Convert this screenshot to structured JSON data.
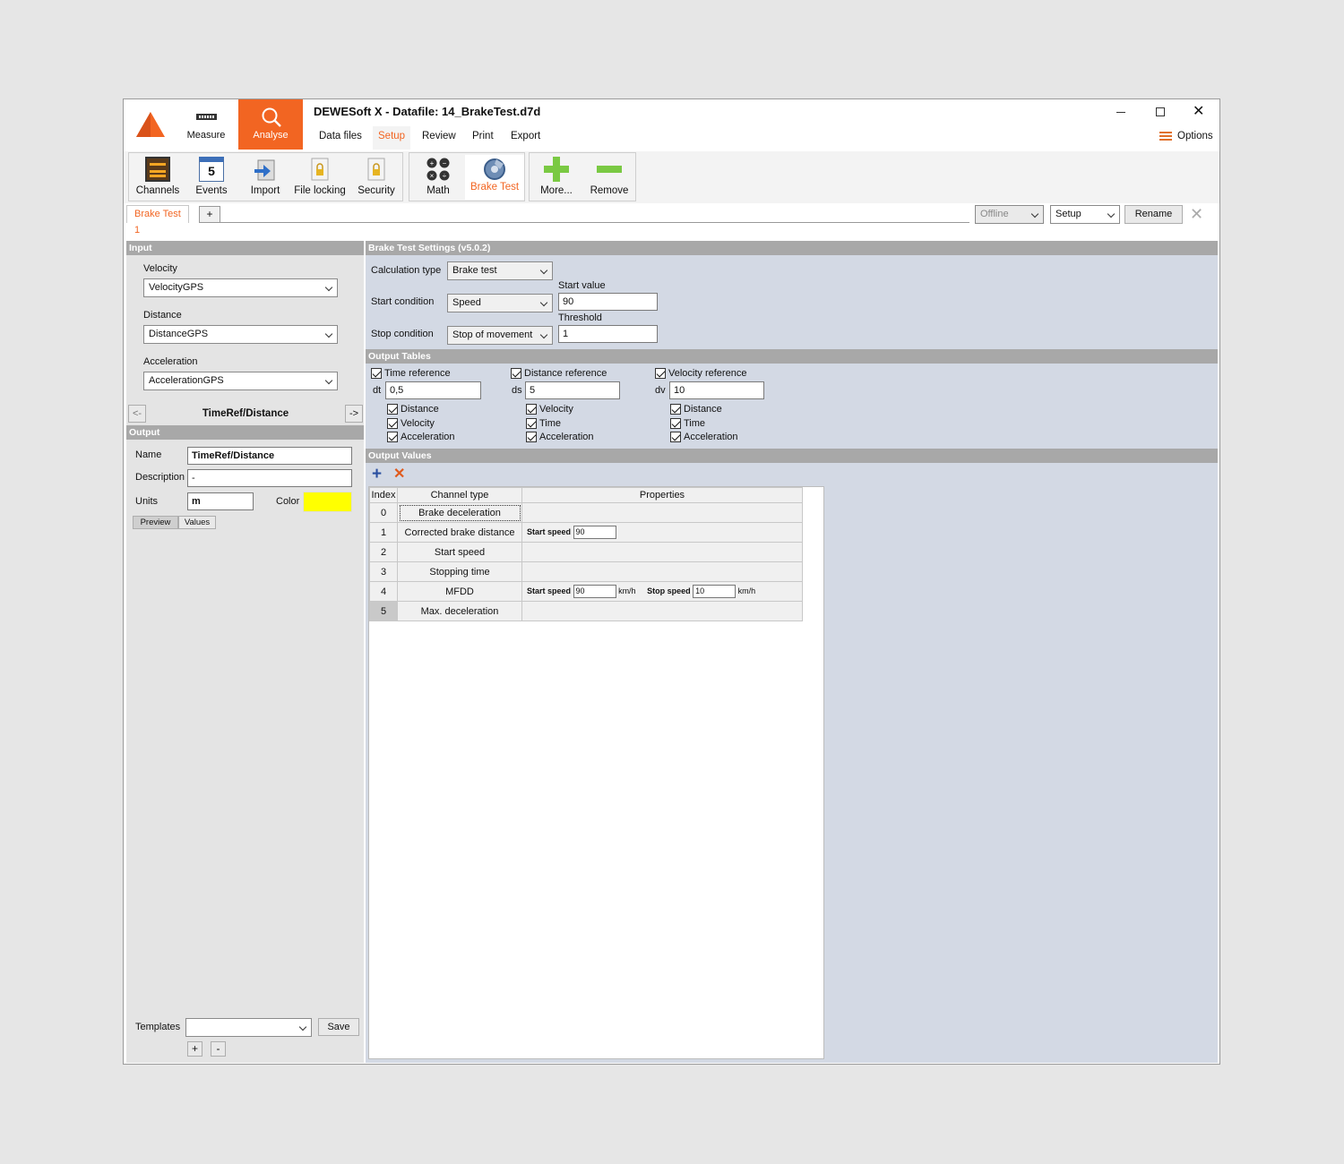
{
  "window": {
    "title": "DEWESoft X - Datafile: 14_BrakeTest.d7d",
    "options_label": "Options"
  },
  "modes": {
    "measure": "Measure",
    "analyse": "Analyse"
  },
  "menu": [
    "Data files",
    "Setup",
    "Review",
    "Print",
    "Export"
  ],
  "toolbar": {
    "channels": "Channels",
    "events": "Events",
    "import": "Import",
    "file_locking": "File locking",
    "security": "Security",
    "math": "Math",
    "brake_test": "Brake Test",
    "more": "More...",
    "remove": "Remove",
    "events_number": "5"
  },
  "tabs": {
    "active": "Brake Test 1",
    "add": "+"
  },
  "header_controls": {
    "offline": "Offline",
    "setup": "Setup",
    "rename": "Rename"
  },
  "input": {
    "section": "Input",
    "velocity_label": "Velocity",
    "velocity_value": "VelocityGPS",
    "distance_label": "Distance",
    "distance_value": "DistanceGPS",
    "acceleration_label": "Acceleration",
    "acceleration_value": "AccelerationGPS",
    "nav_prev": "<-",
    "nav_next": "->",
    "nav_title": "TimeRef/Distance"
  },
  "output": {
    "section": "Output",
    "name_label": "Name",
    "name_value": "TimeRef/Distance",
    "description_label": "Description",
    "description_value": "-",
    "units_label": "Units",
    "units_value": "m",
    "color_label": "Color",
    "color_value": "#ffff00",
    "preview_tab": "Preview",
    "values_tab": "Values"
  },
  "templates": {
    "label": "Templates",
    "save": "Save",
    "add": "+",
    "remove": "-"
  },
  "settings": {
    "section": "Brake Test Settings  (v5.0.2)",
    "calc_type_label": "Calculation type",
    "calc_type_value": "Brake test",
    "start_cond_label": "Start condition",
    "start_cond_value": "Speed",
    "start_value_label": "Start value",
    "start_value": "90",
    "stop_cond_label": "Stop condition",
    "stop_cond_value": "Stop of movement",
    "threshold_label": "Threshold",
    "threshold_value": "1"
  },
  "output_tables": {
    "section": "Output Tables",
    "time_ref": {
      "label": "Time reference",
      "var": "dt",
      "value": "0,5",
      "items": [
        "Distance",
        "Velocity",
        "Acceleration"
      ]
    },
    "distance_ref": {
      "label": "Distance reference",
      "var": "ds",
      "value": "5",
      "items": [
        "Velocity",
        "Time",
        "Acceleration"
      ]
    },
    "velocity_ref": {
      "label": "Velocity reference",
      "var": "dv",
      "value": "10",
      "items": [
        "Distance",
        "Time",
        "Acceleration"
      ]
    }
  },
  "output_values": {
    "section": "Output Values",
    "headers": [
      "Index",
      "Channel type",
      "Properties"
    ],
    "rows": [
      {
        "index": "0",
        "type": "Brake deceleration"
      },
      {
        "index": "1",
        "type": "Corrected brake distance",
        "p1_label": "Start speed",
        "p1_value": "90"
      },
      {
        "index": "2",
        "type": "Start speed"
      },
      {
        "index": "3",
        "type": "Stopping time"
      },
      {
        "index": "4",
        "type": "MFDD",
        "p1_label": "Start speed",
        "p1_value": "90",
        "p1_unit": "km/h",
        "p2_label": "Stop speed",
        "p2_value": "10",
        "p2_unit": "km/h"
      },
      {
        "index": "5",
        "type": "Max. deceleration"
      }
    ]
  }
}
